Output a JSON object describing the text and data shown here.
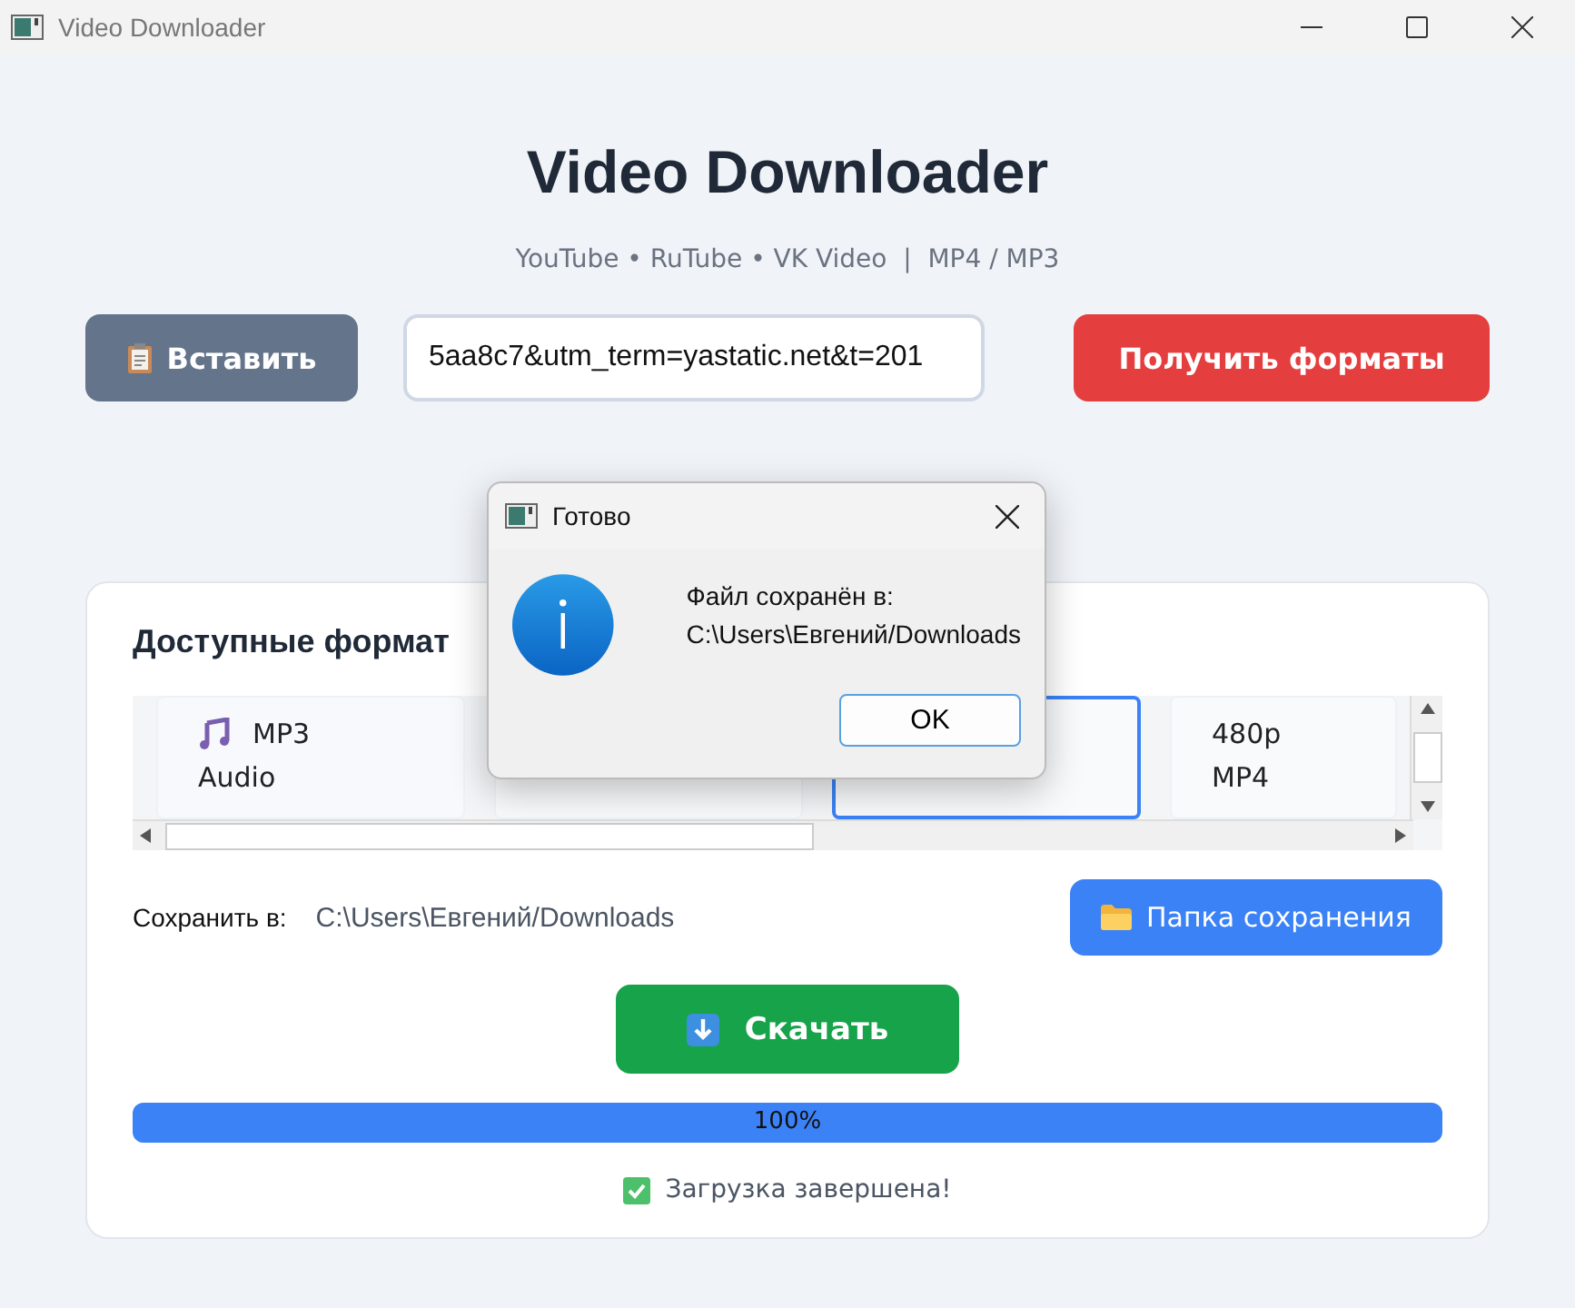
{
  "window": {
    "title": "Video Downloader"
  },
  "header": {
    "title": "Video Downloader",
    "subtitle": "YouTube • RuTube • VK Video  |  MP4 / MP3"
  },
  "toolbar": {
    "paste_button": "Вставить",
    "url_value": "5aa8c7&utm_term=yastatic.net&t=201",
    "get_formats_button": "Получить форматы"
  },
  "formats": {
    "title": "Доступные формат",
    "cards": [
      {
        "kind": "audio",
        "lines": [
          "MP3",
          "Audio"
        ],
        "selected": false
      },
      {
        "kind": "video",
        "selected": false
      },
      {
        "kind": "video",
        "selected": true
      },
      {
        "kind": "video",
        "lines": [
          "480p",
          "MP4"
        ],
        "selected": false
      }
    ]
  },
  "save": {
    "label": "Сохранить в:",
    "path": "C:\\Users\\Евгений/Downloads",
    "folder_button": "Папка сохранения"
  },
  "download_button": "Скачать",
  "progress": {
    "level": 1.0,
    "text": "100%"
  },
  "status": "Загрузка завершена!",
  "dialog": {
    "title": "Готово",
    "message_lines": [
      "Файл сохранён в:",
      "C:\\Users\\Евгений/Downloads"
    ],
    "ok_button": "OK"
  }
}
